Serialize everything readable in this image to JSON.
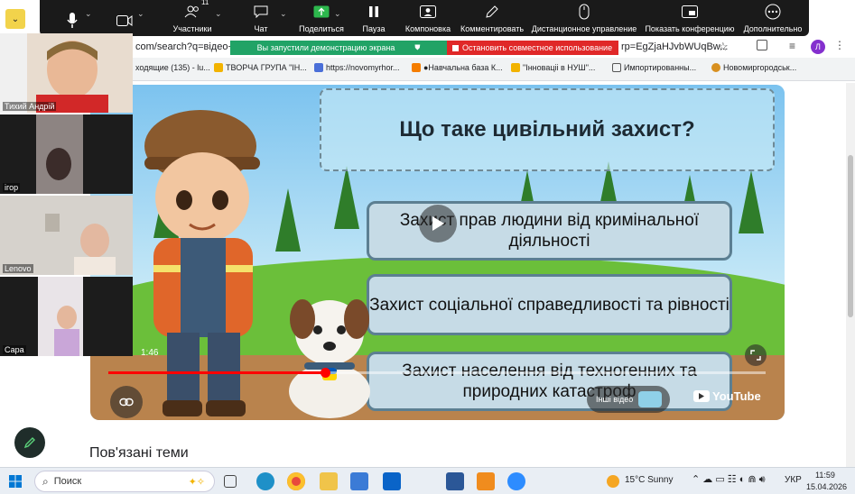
{
  "zoom_toolbar": {
    "participants_count": "11",
    "items": [
      {
        "label": "Участники"
      },
      {
        "label": "Чат"
      },
      {
        "label": "Поделиться"
      },
      {
        "label": "Пауза"
      },
      {
        "label": "Компоновка"
      },
      {
        "label": "Комментировать"
      },
      {
        "label": "Дистанционное управление"
      },
      {
        "label": "Показать конференцию"
      },
      {
        "label": "Дополнительно"
      }
    ]
  },
  "share_banner": {
    "status": "Вы запустили демонстрацию экрана",
    "stop_label": "Остановить совместное использование"
  },
  "browser": {
    "url_left": "com/search?q=відео+д",
    "url_right": "rp=EgZjaHJvbWUqBw...",
    "profile_initial": "Л",
    "bookmarks": [
      "ходящие (135) - lu...",
      "ТВОРЧА ГРУПА \"ІН...",
      "https://novomyrhor...",
      "●Навчальна база К...",
      "\"Інноваціі в НУШ\"...",
      "Импортированны...",
      "Новомиргородськ..."
    ],
    "accent": "#8430ce"
  },
  "video": {
    "question": "Що таке цивільний захист?",
    "answers": [
      "Захист прав людини від кримінальної діяльності",
      "Захист соціальної справедливості та рівності",
      "Захист населення від техногенних та природних катастроф"
    ],
    "time": "1:46",
    "progress": 0.33,
    "more_videos_label": "Інші відео",
    "brand": "YouTube"
  },
  "participants": [
    {
      "name": "Тихий Андрій"
    },
    {
      "name": "ігор"
    },
    {
      "name": "Lenovo"
    },
    {
      "name": "Сара"
    }
  ],
  "page": {
    "related_heading": "Пов'язані теми"
  },
  "taskbar": {
    "search_label": "Поиск",
    "weather": "15°C  Sunny",
    "language": "УКР",
    "time": "11:59",
    "date": "15.04.2026"
  }
}
